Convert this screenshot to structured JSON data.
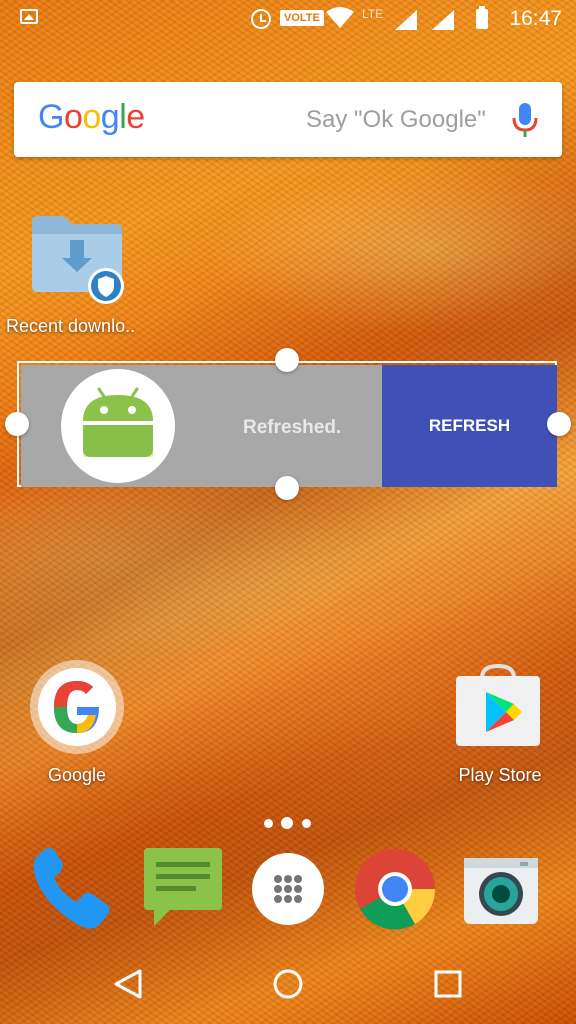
{
  "status_bar": {
    "network_badge": "VOLTE",
    "network_type": "LTE",
    "time": "16:47",
    "icons": [
      "gallery-notification-icon",
      "alarm-icon",
      "wifi-icon",
      "signal-icon",
      "signal-icon",
      "battery-icon"
    ]
  },
  "search": {
    "logo_letters": [
      "G",
      "o",
      "o",
      "g",
      "l",
      "e"
    ],
    "logo_colors": [
      "#4285F4",
      "#EA4335",
      "#FBBC05",
      "#4285F4",
      "#34A853",
      "#EA4335"
    ],
    "hint": "Say \"Ok Google\""
  },
  "desktop": {
    "folder_label": "Recent downlo..",
    "google_label": "Google",
    "playstore_label": "Play Store"
  },
  "widget": {
    "status_text": "Refreshed.",
    "button_label": "REFRESH",
    "accent_color": "#3F51B5"
  },
  "dock": {
    "items": [
      "phone-icon",
      "messages-icon",
      "app-drawer-icon",
      "chrome-icon",
      "camera-icon"
    ]
  },
  "nav_bar": {
    "buttons": [
      "back",
      "home",
      "recents"
    ]
  }
}
